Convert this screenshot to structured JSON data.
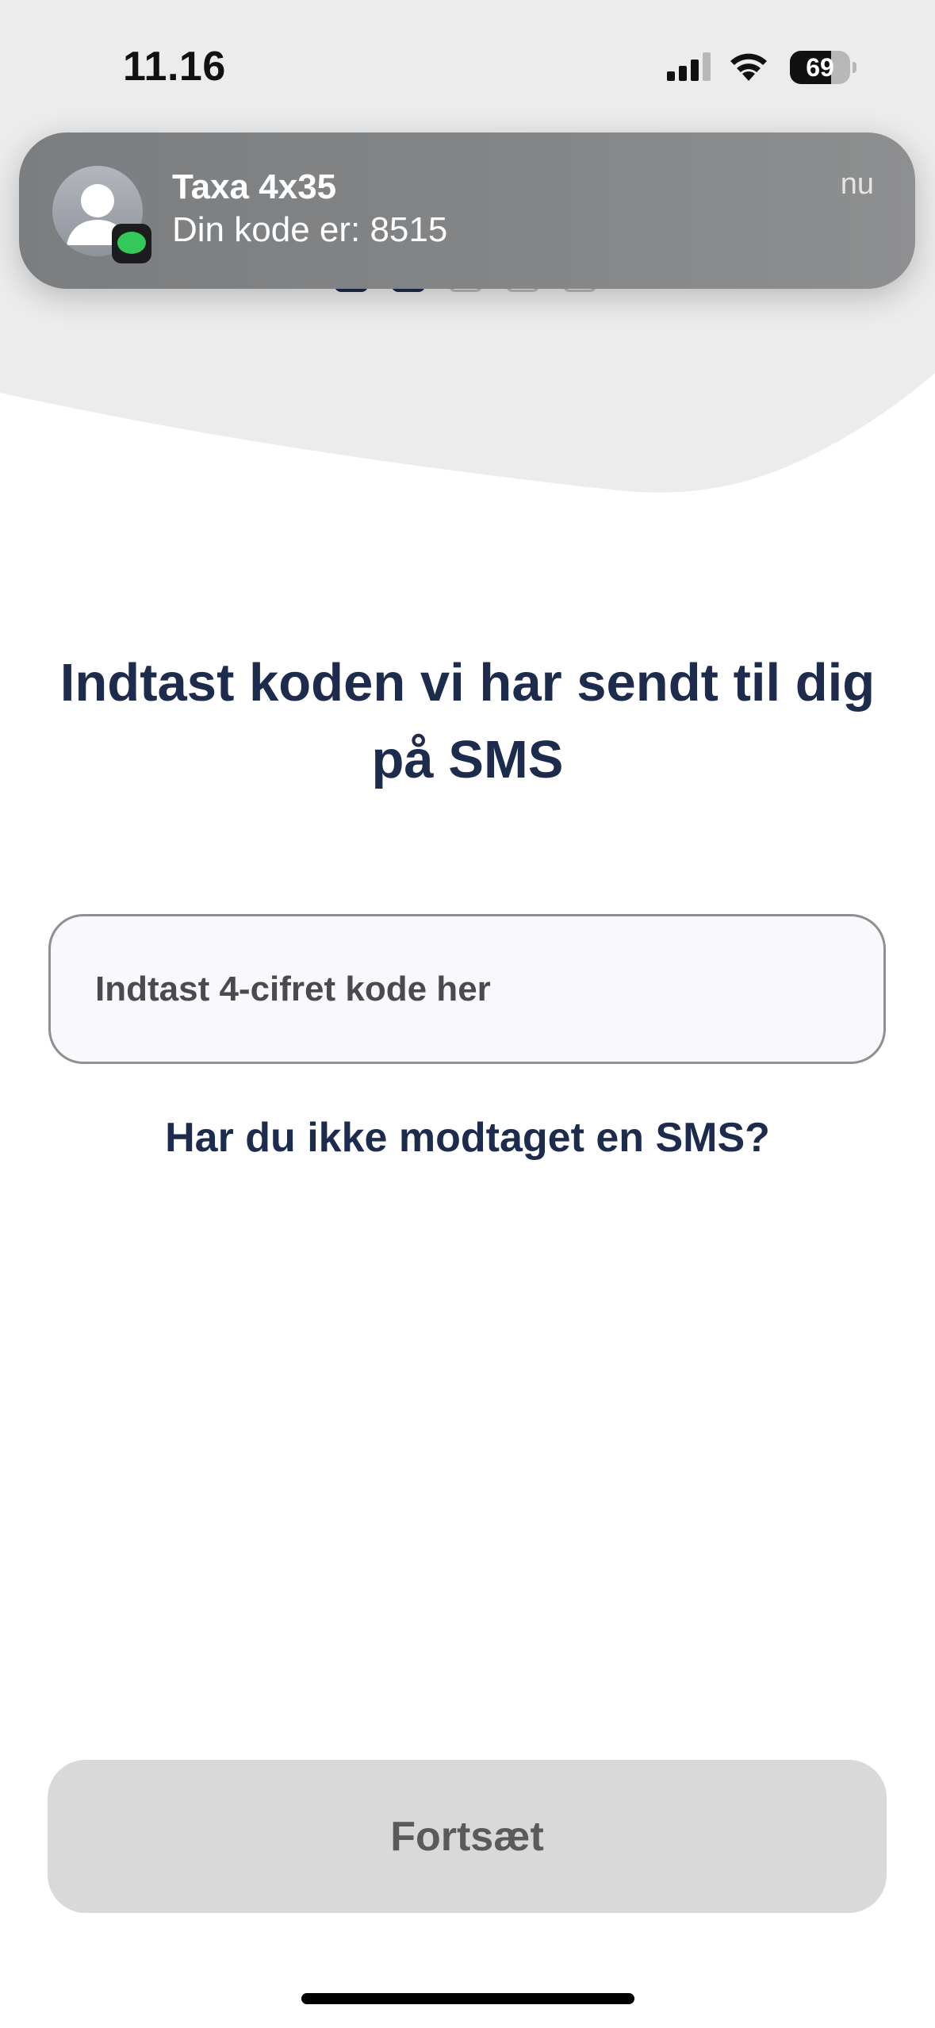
{
  "status_bar": {
    "time": "11.16",
    "battery_level": "69",
    "signal_icon": "cellular-signal-icon",
    "wifi_icon": "wifi-icon",
    "battery_icon": "battery-icon"
  },
  "notification": {
    "sender": "Taxa 4x35",
    "message": "Din kode er: 8515",
    "time": "nu",
    "avatar_icon": "person-silhouette-icon",
    "app_icon": "messages-app-icon"
  },
  "step_indicator": {
    "total_steps": 5,
    "completed_steps": 2
  },
  "main": {
    "heading": "Indtast koden vi har sendt til dig på SMS",
    "code_input": {
      "placeholder": "Indtast 4-cifret kode her",
      "value": ""
    },
    "resend_link": "Har du ikke modtaget en SMS?",
    "continue_button": "Fortsæt"
  },
  "colors": {
    "primary_text": "#1d2b4c",
    "header_background": "#ececec",
    "button_disabled": "#d9d9d9",
    "notification_background": "#838587",
    "messages_green": "#34c759"
  }
}
